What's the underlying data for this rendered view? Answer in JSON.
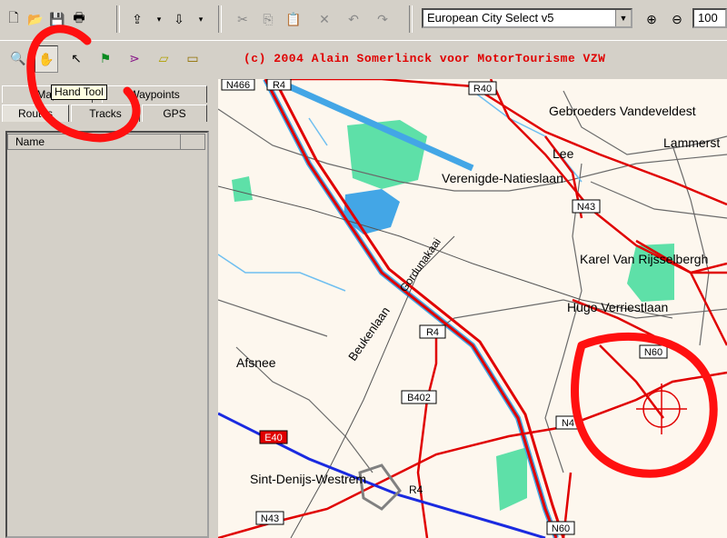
{
  "toolbar": {
    "buttons": [
      "new-icon",
      "open-icon",
      "save-icon",
      "print-icon",
      "upload-icon",
      "download-icon",
      "cut-icon",
      "copy-icon",
      "paste-icon",
      "delete-icon",
      "undo-icon",
      "redo-icon"
    ],
    "map_select": "European City Select v5",
    "zoom_value": "100"
  },
  "tools": {
    "items": [
      "zoom-tool-icon",
      "hand-tool-icon",
      "select-tool-icon",
      "flag-tool-icon",
      "route-tool-icon",
      "polygon-tool-icon",
      "ruler-tool-icon"
    ],
    "tooltip": "Hand Tool"
  },
  "copyright": "(c) 2004 Alain Somerlinck voor MotorTourisme VZW",
  "tabs": {
    "row1": [
      "Map",
      "Waypoints"
    ],
    "row2": [
      "Routes",
      "Tracks",
      "GPS"
    ]
  },
  "list": {
    "header": "Name"
  },
  "map": {
    "labels": {
      "gebroeders": "Gebroeders Vandeveldest",
      "lammerst": "Lammerst",
      "lee": "Lee",
      "verenigde": "Verenigde-Natieslaan",
      "karel": "Karel Van Rijsselbergh",
      "hugo": "Hugo Verriestlaan",
      "afsnee": "Afsnee",
      "beukenlaan": "Beukenlaan",
      "gordunakaai": "Gordunakaai",
      "sintdenijs": "Sint-Denijs-Westrem",
      "ring": "R4"
    },
    "shields": {
      "n466": "N466",
      "r4top": "R4",
      "r40": "R40",
      "n43a": "N43",
      "r4mid": "R4",
      "b402": "B402",
      "n60a": "N60",
      "n4": "N4",
      "e40": "E40",
      "n43b": "N43",
      "n60b": "N60"
    },
    "colors": {
      "background": "#fdf7ee",
      "water": "#43a6e6",
      "park": "#5ee0a8",
      "road": "#e00000",
      "motorway": "#1a2ae0"
    }
  }
}
